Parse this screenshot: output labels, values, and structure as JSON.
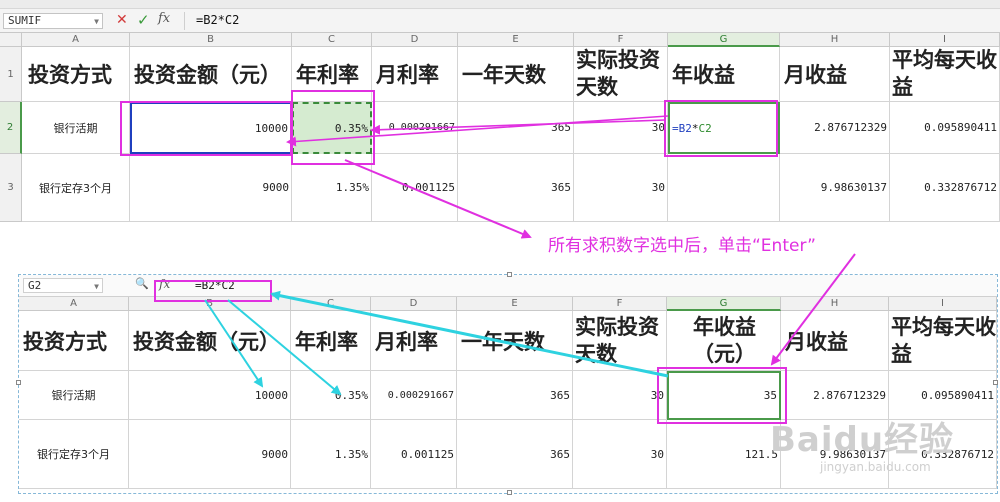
{
  "top": {
    "name_box": "SUMIF",
    "cancel_icon": "✕",
    "confirm_icon": "✓",
    "fx": "fx",
    "formula": "=B2*C2",
    "columns": [
      "A",
      "B",
      "C",
      "D",
      "E",
      "F",
      "G",
      "H",
      "I"
    ],
    "rows": [
      "1",
      "2",
      "3"
    ],
    "headers": [
      "投资方式",
      "投资金额（元）",
      "年利率",
      "月利率",
      "一年天数",
      "实际投资天数",
      "年收益",
      "月收益",
      "平均每天收益"
    ],
    "row2": {
      "a": "银行活期",
      "b": "10000",
      "c": "0.35%",
      "d": "0.000291667",
      "e": "365",
      "f": "30",
      "g_prefix": "=B2",
      "g_op": "*",
      "g_ref": "C2",
      "h": "2.876712329",
      "i": "0.095890411"
    },
    "row3": {
      "a": "银行定存3个月",
      "b": "9000",
      "c": "1.35%",
      "d": "0.001125",
      "e": "365",
      "f": "30",
      "g": "",
      "h": "9.98630137",
      "i": "0.332876712"
    }
  },
  "annotation": "所有求积数字选中后，单击“Enter”",
  "bottom": {
    "name_box": "G2",
    "zoom_icon": "🔍",
    "fx": "fx",
    "formula": "=B2*C2",
    "columns": [
      "A",
      "B",
      "C",
      "D",
      "E",
      "F",
      "G",
      "H",
      "I"
    ],
    "headers": [
      "投资方式",
      "投资金额（元）",
      "年利率",
      "月利率",
      "一年天数",
      "实际投资天数",
      "年收益（元）",
      "月收益",
      "平均每天收益"
    ],
    "row2": {
      "a": "银行活期",
      "b": "10000",
      "c": "0.35%",
      "d": "0.000291667",
      "e": "365",
      "f": "30",
      "g": "35",
      "h": "2.876712329",
      "i": "0.095890411"
    },
    "row3": {
      "a": "银行定存3个月",
      "b": "9000",
      "c": "1.35%",
      "d": "0.001125",
      "e": "365",
      "f": "30",
      "g": "121.5",
      "h": "9.98630137",
      "i": "0.332876712"
    }
  },
  "watermark": {
    "brand": "Baidu经验",
    "url": "jingyan.baidu.com"
  },
  "colors": {
    "magenta": "#e030e0",
    "cyan": "#2ed2e0",
    "selection_green": "#4a9a4a",
    "fill_green": "#d5ebd0",
    "ref_blue": "#1f3fbf"
  }
}
